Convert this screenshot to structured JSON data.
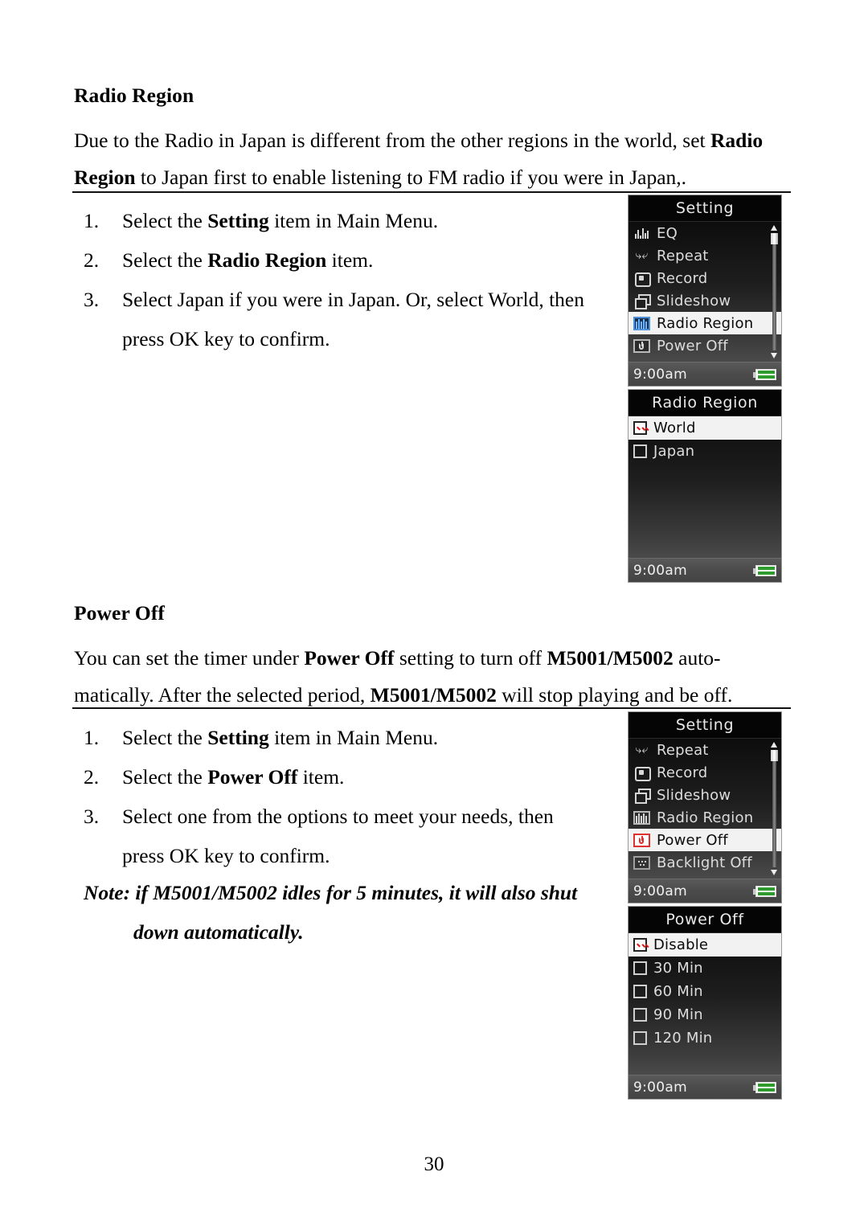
{
  "page": {
    "number": "30"
  },
  "sections": [
    {
      "heading": "Radio Region",
      "intro_line1_a": "Due to the Radio in Japan is different from the other regions in the world, set ",
      "intro_line1_b": "Radio",
      "intro_line2_a": "Region",
      "intro_line2_b": " to Japan first to enable listening to FM radio if you were in Japan,.",
      "steps": [
        {
          "num": "1.",
          "pre": "Select the ",
          "bold": "Setting",
          "post": " item in Main Menu."
        },
        {
          "num": "2.",
          "pre": "Select the ",
          "bold": "Radio Region",
          "post": " item."
        },
        {
          "num": "3.",
          "pre": "Select Japan if you were in Japan. Or, select World, then press OK key to confirm.",
          "bold": "",
          "post": ""
        }
      ]
    },
    {
      "heading": "Power Off",
      "intro_line1_a": "You can set the timer under ",
      "intro_line1_b": "Power Off",
      "intro_line1_c": " setting to turn off ",
      "intro_line1_d": "M5001/M5002",
      "intro_line1_e": " auto-",
      "intro_line2_a": "matically. After the selected period, ",
      "intro_line2_b": "M5001/M5002",
      "intro_line2_c": " will stop playing and be off.",
      "steps": [
        {
          "num": "1.",
          "pre": "Select the ",
          "bold": "Setting",
          "post": " item in Main Menu."
        },
        {
          "num": "2.",
          "pre": "Select the ",
          "bold": "Power Off",
          "post": " item."
        },
        {
          "num": "3.",
          "pre": "Select one from the options to meet your needs, then press OK key to confirm.",
          "bold": "",
          "post": ""
        }
      ],
      "note_line1": "Note: if M5001/M5002 idles for 5 minutes, it will also shut",
      "note_line2": "down automatically."
    }
  ],
  "screens": [
    {
      "id": "setting-menu-radio",
      "title": "Setting",
      "type": "menu",
      "scrollbar": true,
      "items": [
        {
          "label": "EQ",
          "icon": "eq-icon",
          "selected": false
        },
        {
          "label": "Repeat",
          "icon": "repeat-icon",
          "selected": false
        },
        {
          "label": "Record",
          "icon": "record-icon",
          "selected": false
        },
        {
          "label": "Slideshow",
          "icon": "slideshow-icon",
          "selected": false
        },
        {
          "label": "Radio Region",
          "icon": "radio-region-icon",
          "selected": true
        },
        {
          "label": "Power Off",
          "icon": "power-off-icon",
          "selected": false
        }
      ],
      "status": {
        "time": "9:00am",
        "battery": "battery-icon"
      }
    },
    {
      "id": "radio-region-options",
      "title": "Radio Region",
      "type": "options",
      "scrollbar": false,
      "items": [
        {
          "label": "World",
          "checked": true,
          "selected": true
        },
        {
          "label": "Japan",
          "checked": false,
          "selected": false
        }
      ],
      "status": {
        "time": "9:00am",
        "battery": "battery-icon"
      }
    },
    {
      "id": "setting-menu-power",
      "title": "Setting",
      "type": "menu",
      "scrollbar": true,
      "items": [
        {
          "label": "Repeat",
          "icon": "repeat-icon",
          "selected": false
        },
        {
          "label": "Record",
          "icon": "record-icon",
          "selected": false
        },
        {
          "label": "Slideshow",
          "icon": "slideshow-icon",
          "selected": false
        },
        {
          "label": "Radio Region",
          "icon": "radio-region-icon",
          "selected": false
        },
        {
          "label": "Power Off",
          "icon": "power-off-icon",
          "selected": true
        },
        {
          "label": "Backlight Off",
          "icon": "backlight-off-icon",
          "selected": false
        }
      ],
      "status": {
        "time": "9:00am",
        "battery": "battery-icon"
      }
    },
    {
      "id": "power-off-options",
      "title": "Power Off",
      "type": "options",
      "scrollbar": false,
      "items": [
        {
          "label": "Disable",
          "checked": true,
          "selected": true
        },
        {
          "label": "30 Min",
          "checked": false,
          "selected": false
        },
        {
          "label": "60 Min",
          "checked": false,
          "selected": false
        },
        {
          "label": "90 Min",
          "checked": false,
          "selected": false
        },
        {
          "label": "120 Min",
          "checked": false,
          "selected": false
        }
      ],
      "status": {
        "time": "9:00am",
        "battery": "battery-icon"
      }
    }
  ],
  "colors": {
    "accent_blue": "#4f8fd8",
    "check_red": "#e01010",
    "power_red": "#e03030",
    "battery_green": "#2f9b2f",
    "selected_row_bg": "#f2f2f2"
  }
}
